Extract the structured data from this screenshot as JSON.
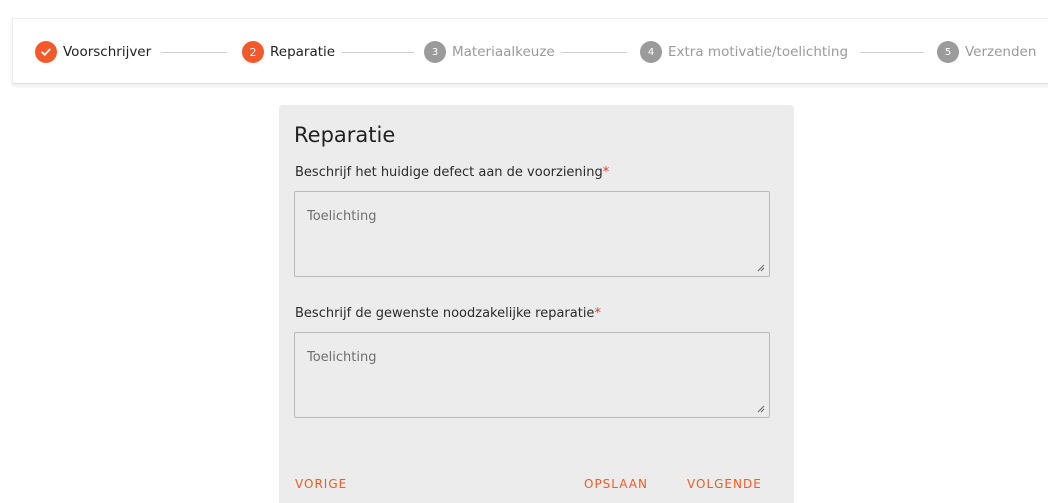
{
  "stepper": {
    "steps": [
      {
        "number": "",
        "label": "Voorschrijver",
        "state": "done"
      },
      {
        "number": "2",
        "label": "Reparatie",
        "state": "active"
      },
      {
        "number": "3",
        "label": "Materiaalkeuze",
        "state": "todo"
      },
      {
        "number": "4",
        "label": "Extra motivatie/toelichting",
        "state": "todo"
      },
      {
        "number": "5",
        "label": "Verzenden",
        "state": "todo"
      }
    ]
  },
  "form": {
    "title": "Reparatie",
    "fields": [
      {
        "label": "Beschrijf het huidige defect aan de voorziening",
        "required_mark": "*",
        "placeholder": "Toelichting",
        "value": ""
      },
      {
        "label": "Beschrijf de gewenste noodzakelijke reparatie",
        "required_mark": "*",
        "placeholder": "Toelichting",
        "value": ""
      }
    ],
    "buttons": {
      "previous": "VORIGE",
      "save": "OPSLAAN",
      "next": "VOLGENDE"
    }
  },
  "colors": {
    "accent": "#f25a2b",
    "inactive_step": "#9b9b9b",
    "required": "#e53935",
    "card_background": "#ececec"
  }
}
